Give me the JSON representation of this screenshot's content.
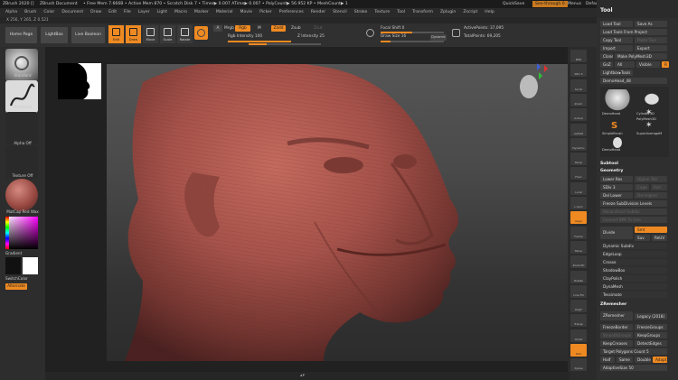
{
  "titlebar": {
    "app": "ZBrush 2020 []",
    "doc": "ZBrush Document",
    "stats": "• Free Mem 7.666B • Active Mem 870 • Scratch Disk 7 • Timer▶ 0.007 ATime▶ 0.007 • PolyCount▶ 56.952 KP • MeshCount▶ 1",
    "quicksave": "QuickSave",
    "seethrough": "See-through 0",
    "menus": "Menus",
    "script": "DefaultZScript"
  },
  "menubar": [
    "Alpha",
    "Brush",
    "Color",
    "Document",
    "Draw",
    "Edit",
    "File",
    "Layer",
    "Light",
    "Macro",
    "Marker",
    "Material",
    "Movie",
    "Picker",
    "Preferences",
    "Render",
    "Stencil",
    "Stroke",
    "Texture",
    "Tool",
    "Transform",
    "Zplugin",
    "Zscript",
    "Help"
  ],
  "coords": "X 256, Y 265, Z 0.521",
  "shelf": {
    "home": "Home Page",
    "lightbox": "LightBox",
    "liveboolean": "Live Boolean",
    "edit": "Edit",
    "draw": "Draw",
    "move": "Move",
    "scale": "Scale",
    "rotate": "Rotate",
    "a": "A",
    "mrgb": "Mrgb",
    "rgb": "Rgb",
    "m": "M",
    "zadd": "Zadd",
    "zsub": "Zsub",
    "zcut": "Zcut",
    "rgb_intensity": "Rgb Intensity 100",
    "z_intensity": "Z Intensity 25",
    "rgb_fill": 1.0,
    "z_fill": 0.25,
    "focal_shift": "Focal Shift 0",
    "draw_size": "Draw Size 16",
    "dynamic": "Dynamic",
    "active_points": "ActivePoints: 37,095",
    "total_points": "TotalPoints: 69,205",
    "draw_fill": 0.16
  },
  "leftshelf": {
    "brush": "Standard",
    "stroke": "FreeHand",
    "alpha": "Alpha Off",
    "texture": "Texture Off",
    "material": "MatCap Red Wax",
    "gradient": "Gradient",
    "switchcolor": "SwitchColor",
    "alternate": "Alternate"
  },
  "rightshelf": [
    {
      "name": "bpr",
      "label": "BPR",
      "on": false
    },
    {
      "name": "spix",
      "label": "SPix 3",
      "on": false
    },
    {
      "name": "scroll",
      "label": "Scroll",
      "on": false
    },
    {
      "name": "zoom",
      "label": "Zoom",
      "on": false
    },
    {
      "name": "actual",
      "label": "Actual",
      "on": false
    },
    {
      "name": "aahalf",
      "label": "AAHalf",
      "on": false
    },
    {
      "name": "dynamic",
      "label": "Dynamic",
      "on": false
    },
    {
      "name": "persp",
      "label": "Persp",
      "on": false
    },
    {
      "name": "floor",
      "label": "Floor",
      "on": false
    },
    {
      "name": "local",
      "label": "Local",
      "on": false
    },
    {
      "name": "lsym",
      "label": "L.Sym",
      "on": false
    },
    {
      "name": "xyz",
      "label": "Gxyz",
      "on": true
    },
    {
      "name": "frame",
      "label": "Frame",
      "on": false
    },
    {
      "name": "move",
      "label": "Move",
      "on": false
    },
    {
      "name": "zoom3d",
      "label": "Zoom3D",
      "on": false
    },
    {
      "name": "rotate",
      "label": "Rotate",
      "on": false
    },
    {
      "name": "linefill",
      "label": "Line Fill",
      "on": false
    },
    {
      "name": "polyf",
      "label": "PolyF",
      "on": false
    },
    {
      "name": "transp",
      "label": "Transp",
      "on": false
    },
    {
      "name": "ghost",
      "label": "Ghost",
      "on": false
    },
    {
      "name": "solo",
      "label": "Solo",
      "on": true
    },
    {
      "name": "xpose",
      "label": "Xpose",
      "on": false
    }
  ],
  "palette": {
    "title": "Tool",
    "load_tool": "Load Tool",
    "save_as": "Save As",
    "load_from_project": "Load Tools From Project",
    "copy_tool": "Copy Tool",
    "paste_tool": "Paste Tool",
    "import": "Import",
    "export": "Export",
    "clone": "Clone",
    "make_polymesh": "Make PolyMesh3D",
    "goz": "GoZ",
    "all": "All",
    "visible": "Visible",
    "r": "R",
    "lightbox_tools": "Lightbox▸Tools",
    "current_tool": "DemoHead_48",
    "tools": [
      "DemoHead",
      "Cylinder3D",
      "PolyMesh3D",
      "SimpleBrush",
      "SuperAverageM",
      "DemoHead"
    ],
    "subtool": "Subtool",
    "geometry": "Geometry",
    "lower_res": "Lower Res",
    "higher_res": "Higher Res",
    "sdiv": "SDiv 3",
    "cage": "Cage",
    "rstr": "Rstr",
    "del_lower": "Del Lower",
    "del_higher": "Del Higher",
    "freeze": "Freeze SubDivision Levels",
    "reconstruct": "Reconstruct Subdiv",
    "convert_bpr": "Convert BPR To Geo",
    "divide": "Divide",
    "smt": "Smt",
    "suv": "Suv",
    "reuv": "ReUV",
    "dynamic_subdiv": "Dynamic Subdiv",
    "edgeloop": "EdgeLoop",
    "crease": "Crease",
    "shadowbox": "ShadowBox",
    "claypolish": "ClayPolish",
    "dynamesh": "DynaMesh",
    "tessimate": "Tessimate",
    "zremesher_head": "ZRemesher",
    "zremesher": "ZRemesher",
    "legacy": "Legacy (2018)",
    "freezeborder": "FreezeBorder",
    "freezegroups": "FreezeGroups",
    "smoothgroups": "SmoothGroups",
    "keepgroups": "KeepGroups",
    "keepcreases": "KeepCreases",
    "detectedges": "DetectEdges",
    "target_count": "Target Polygons Count 5",
    "half": "Half",
    "same": "Same",
    "double": "Double",
    "adapt": "Adapt",
    "adaptivesize": "AdaptiveSize 50"
  },
  "colors": {
    "accent": "#ef8a22",
    "clay": "#a8524a",
    "panel": "#2f2f2f"
  }
}
